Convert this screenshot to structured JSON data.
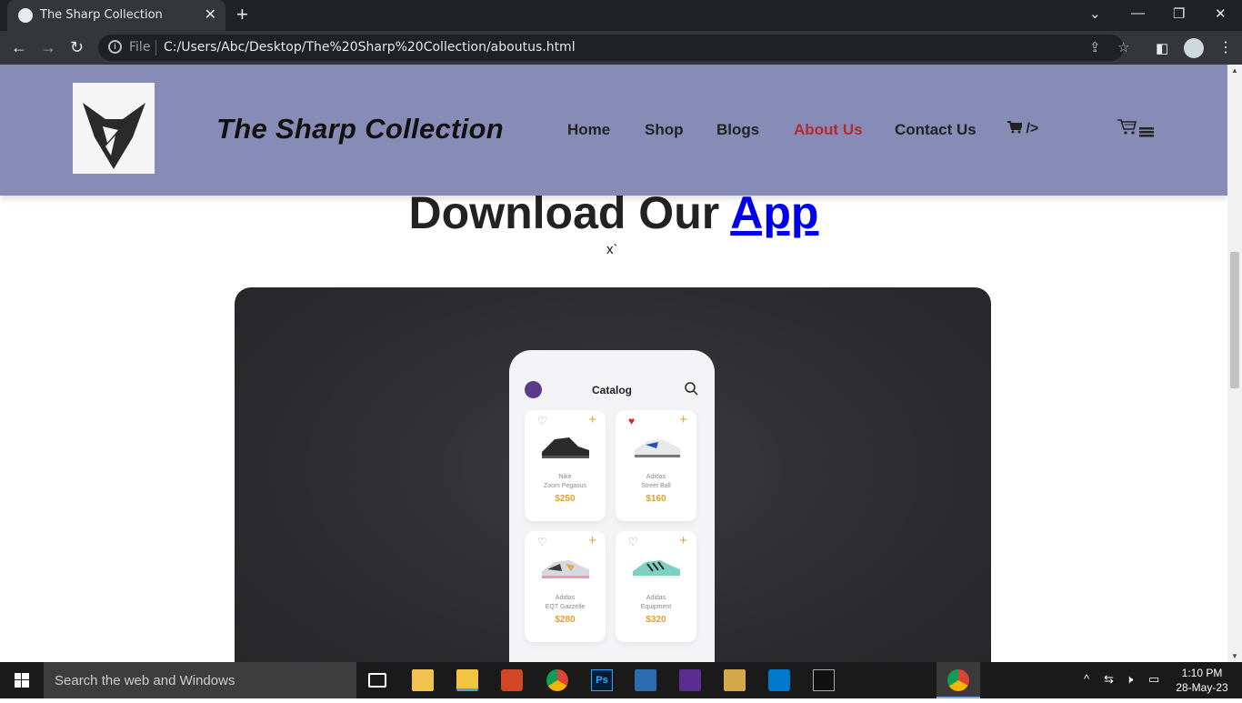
{
  "browser": {
    "tab_title": "The Sharp Collection",
    "file_label": "File",
    "url": "C:/Users/Abc/Desktop/The%20Sharp%20Collection/aboutus.html"
  },
  "site": {
    "brand": "The Sharp Collection",
    "nav": [
      "Home",
      "Shop",
      "Blogs",
      "About Us",
      "Contact Us"
    ],
    "active_nav": "About Us",
    "cart_nav_text": "/>",
    "accent_color": "#b8292f",
    "header_color": "#868cb6"
  },
  "main": {
    "heading_prefix": "Download Our",
    "heading_link": "App",
    "stray_text": "x`"
  },
  "phone": {
    "title": "Catalog",
    "products": [
      {
        "brand": "Nike",
        "model": "Zoom Pegasus",
        "price": "$250",
        "favorited": true
      },
      {
        "brand": "Adidas",
        "model": "Street Ball",
        "price": "$160",
        "favorited": true
      },
      {
        "brand": "Adidas",
        "model": "EQT Gazzelle",
        "price": "$280",
        "favorited": false
      },
      {
        "brand": "Adidas",
        "model": "Equipment",
        "price": "$320",
        "favorited": false
      }
    ]
  },
  "taskbar": {
    "search_placeholder": "Search the web and Windows",
    "time": "1:10 PM",
    "date": "28-May-23"
  }
}
